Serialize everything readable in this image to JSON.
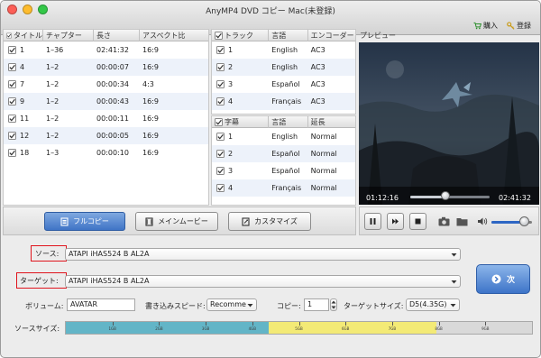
{
  "window": {
    "title": "AnyMP4 DVD コピー Mac(未登録)",
    "buy_label": "購入",
    "register_label": "登録"
  },
  "titles_table": {
    "headers": [
      "タイトル",
      "チャプター",
      "長さ",
      "アスペクト比"
    ],
    "rows": [
      {
        "title": "1",
        "chapters": "1–36",
        "length": "02:41:32",
        "aspect": "16:9",
        "checked": true
      },
      {
        "title": "4",
        "chapters": "1–2",
        "length": "00:00:07",
        "aspect": "16:9",
        "checked": true
      },
      {
        "title": "7",
        "chapters": "1–2",
        "length": "00:00:34",
        "aspect": "4:3",
        "checked": true
      },
      {
        "title": "9",
        "chapters": "1–2",
        "length": "00:00:43",
        "aspect": "16:9",
        "checked": true
      },
      {
        "title": "11",
        "chapters": "1–2",
        "length": "00:00:11",
        "aspect": "16:9",
        "checked": true
      },
      {
        "title": "12",
        "chapters": "1–2",
        "length": "00:00:05",
        "aspect": "16:9",
        "checked": true
      },
      {
        "title": "18",
        "chapters": "1–3",
        "length": "00:00:10",
        "aspect": "16:9",
        "checked": true
      }
    ]
  },
  "audio_table": {
    "headers": [
      "トラック",
      "言語",
      "エンコーダー"
    ],
    "rows": [
      {
        "track": "1",
        "language": "English",
        "encoder": "AC3"
      },
      {
        "track": "2",
        "language": "English",
        "encoder": "AC3"
      },
      {
        "track": "3",
        "language": "Español",
        "encoder": "AC3"
      },
      {
        "track": "4",
        "language": "Français",
        "encoder": "AC3"
      }
    ]
  },
  "subtitle_table": {
    "headers": [
      "字幕",
      "言語",
      "延長"
    ],
    "rows": [
      {
        "track": "1",
        "language": "English",
        "extension": "Normal"
      },
      {
        "track": "2",
        "language": "Español",
        "extension": "Normal"
      },
      {
        "track": "3",
        "language": "Español",
        "extension": "Normal"
      },
      {
        "track": "4",
        "language": "Français",
        "extension": "Normal"
      }
    ]
  },
  "preview": {
    "label": "プレビュー",
    "current_time": "01:12:16",
    "total_time": "02:41:32",
    "progress": 0.447,
    "volume": 0.8
  },
  "modes": {
    "full_copy": "フルコピー",
    "main_movie": "メインムービー",
    "customize": "カスタマイズ",
    "active": "full_copy"
  },
  "form": {
    "source_label": "ソース:",
    "source_value": "ATAPI iHAS524   B AL2A",
    "target_label": "ターゲット:",
    "target_value": "ATAPI iHAS524   B AL2A",
    "volume_label": "ボリューム:",
    "volume_value": "AVATAR",
    "write_speed_label": "書き込みスピード:",
    "write_speed_value": "Recomme",
    "copies_label": "コピー:",
    "copies_value": "1",
    "target_size_label": "ターゲットサイズ:",
    "target_size_value": "D5(4.35G)",
    "next_label": "次",
    "source_size_label": "ソースサイズ:"
  },
  "size_bar": {
    "ticks": [
      "1GB",
      "2GB",
      "3GB",
      "4GB",
      "5GB",
      "6GB",
      "7GB",
      "8GB",
      "9GB"
    ],
    "max_gb": 10,
    "blue_end_gb": 4.35,
    "yellow_end_gb": 7.95
  },
  "colors": {
    "accent_blue": "#3f74c6",
    "highlight_red": "#e0141d",
    "size_blue": "#63b5c7",
    "size_yellow": "#f3ea76",
    "size_gray": "#d9d9d9"
  }
}
